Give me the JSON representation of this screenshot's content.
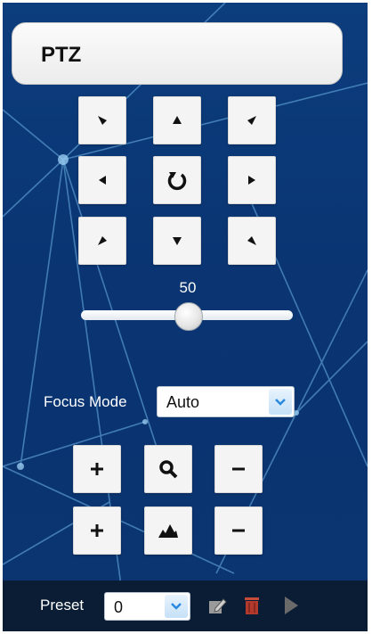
{
  "header": {
    "title": "PTZ"
  },
  "ptz_pad": {
    "buttons": [
      "up-left",
      "up",
      "up-right",
      "left",
      "auto-rotate",
      "right",
      "down-left",
      "down",
      "down-right"
    ]
  },
  "speed": {
    "value": "50",
    "level_percent": 50
  },
  "focus": {
    "label": "Focus Mode",
    "selected": "Auto",
    "buttons": [
      "zoom-in",
      "zoom",
      "zoom-out",
      "focus-in",
      "focus",
      "focus-out"
    ]
  },
  "preset": {
    "label": "Preset",
    "selected": "0",
    "icons": [
      "edit-icon",
      "delete-icon",
      "play-icon"
    ]
  },
  "colors": {
    "background": "#0c3d7d",
    "header": "#f4f4f4",
    "footer": "#0a1d35",
    "dropdown_arrow": "#2a8ae0"
  }
}
